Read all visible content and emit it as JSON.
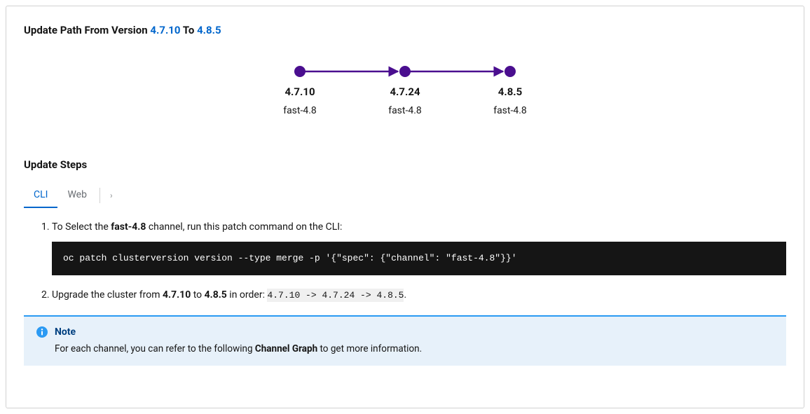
{
  "title": {
    "prefix": "Update Path From Version ",
    "from_version": "4.7.10",
    "mid": " To ",
    "to_version": "4.8.5"
  },
  "graph": {
    "color": "#4a0e8f",
    "nodes": [
      {
        "version": "4.7.10",
        "channel": "fast-4.8"
      },
      {
        "version": "4.7.24",
        "channel": "fast-4.8"
      },
      {
        "version": "4.8.5",
        "channel": "fast-4.8"
      }
    ]
  },
  "steps_heading": "Update Steps",
  "tabs": {
    "items": [
      "CLI",
      "Web"
    ],
    "active_index": 0,
    "more_glyph": "›"
  },
  "steps": {
    "step1": {
      "pre": "To Select the ",
      "channel_bold": "fast-4.8",
      "post": " channel, run this patch command on the CLI:",
      "code": "oc patch clusterversion version --type merge -p '{\"spec\": {\"channel\": \"fast-4.8\"}}'"
    },
    "step2": {
      "pre": "Upgrade the cluster from ",
      "from_bold": "4.7.10",
      "mid": " to ",
      "to_bold": "4.8.5",
      "post1": " in order: ",
      "order_code": "4.7.10 -> 4.7.24 -> 4.8.5",
      "suffix": "."
    }
  },
  "note": {
    "title": "Note",
    "body_pre": "For each channel, you can refer to the following ",
    "body_bold": "Channel Graph",
    "body_post": " to get more information."
  }
}
